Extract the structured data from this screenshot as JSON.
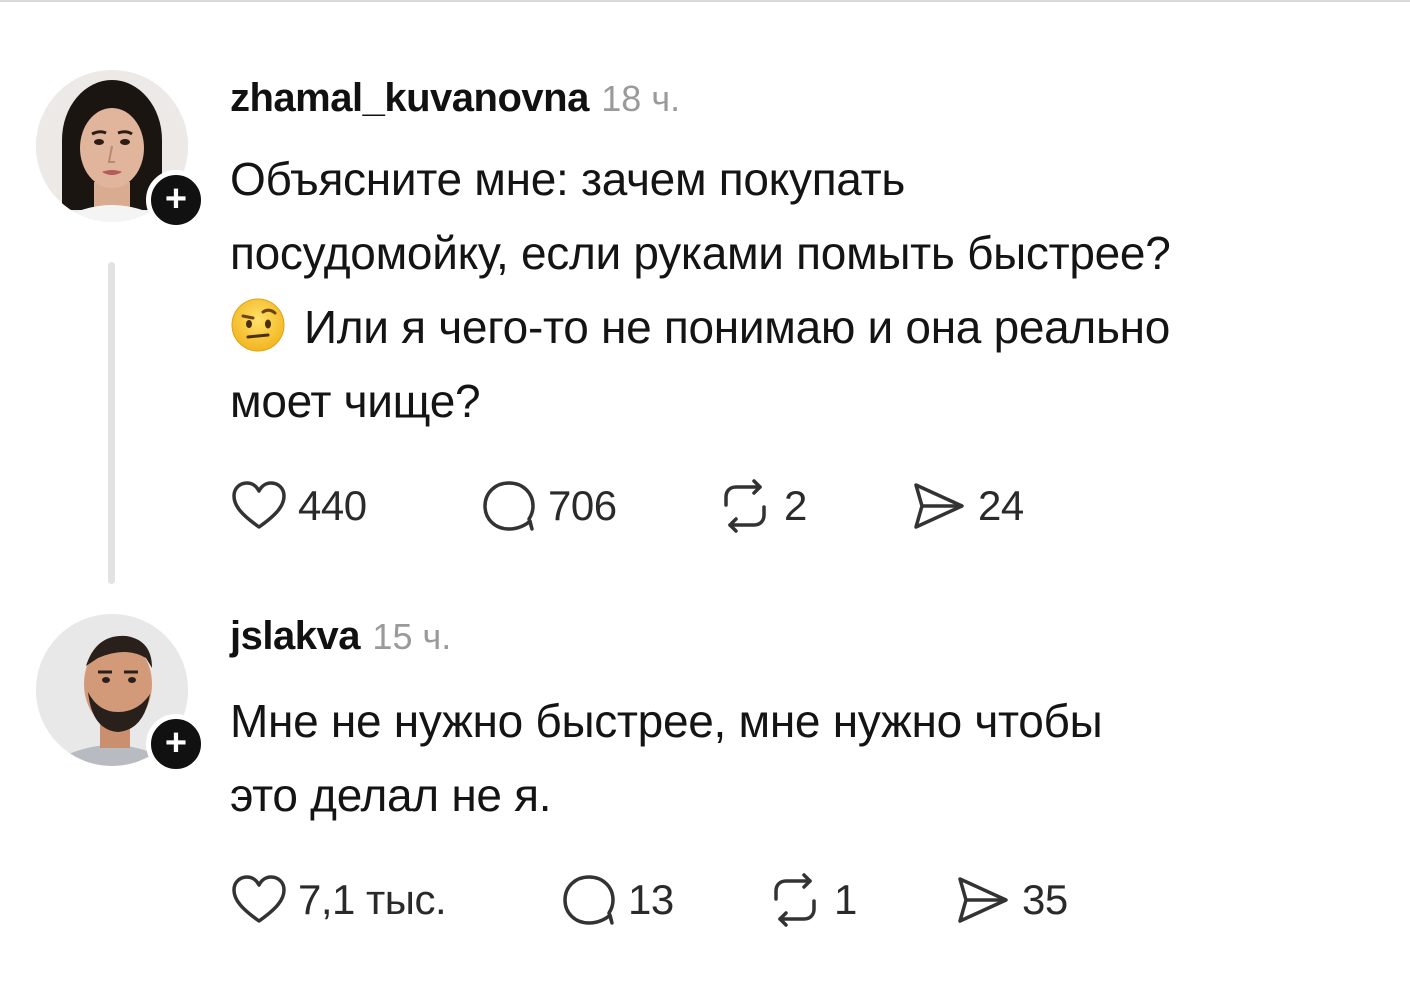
{
  "posts": [
    {
      "username": "zhamal_kuvanovna",
      "time": "18 ч.",
      "text_line1": "Объясните мне: зачем покупать",
      "text_line2": "посудомойку, если руками помыть быстрее?",
      "text_line3": "Или я чего-то не понимаю и она реально",
      "text_line4": "моет чище?",
      "emoji": "face-with-raised-eyebrow-icon",
      "likes": "440",
      "replies": "706",
      "reposts": "2",
      "shares": "24"
    },
    {
      "username": "jslakva",
      "time": "15 ч.",
      "text_line1": "Мне не нужно быстрее, мне нужно чтобы",
      "text_line2": "это делал не я.",
      "likes": "7,1 тыс.",
      "replies": "13",
      "reposts": "1",
      "shares": "35"
    }
  ],
  "icons": {
    "follow": "+",
    "like": "heart-icon",
    "reply": "comment-bubble-icon",
    "repost": "repost-icon",
    "share": "send-icon"
  },
  "colors": {
    "text": "#141414",
    "muted": "#9a9a9a",
    "thread_line": "#e2e2e2",
    "badge": "#111111"
  }
}
